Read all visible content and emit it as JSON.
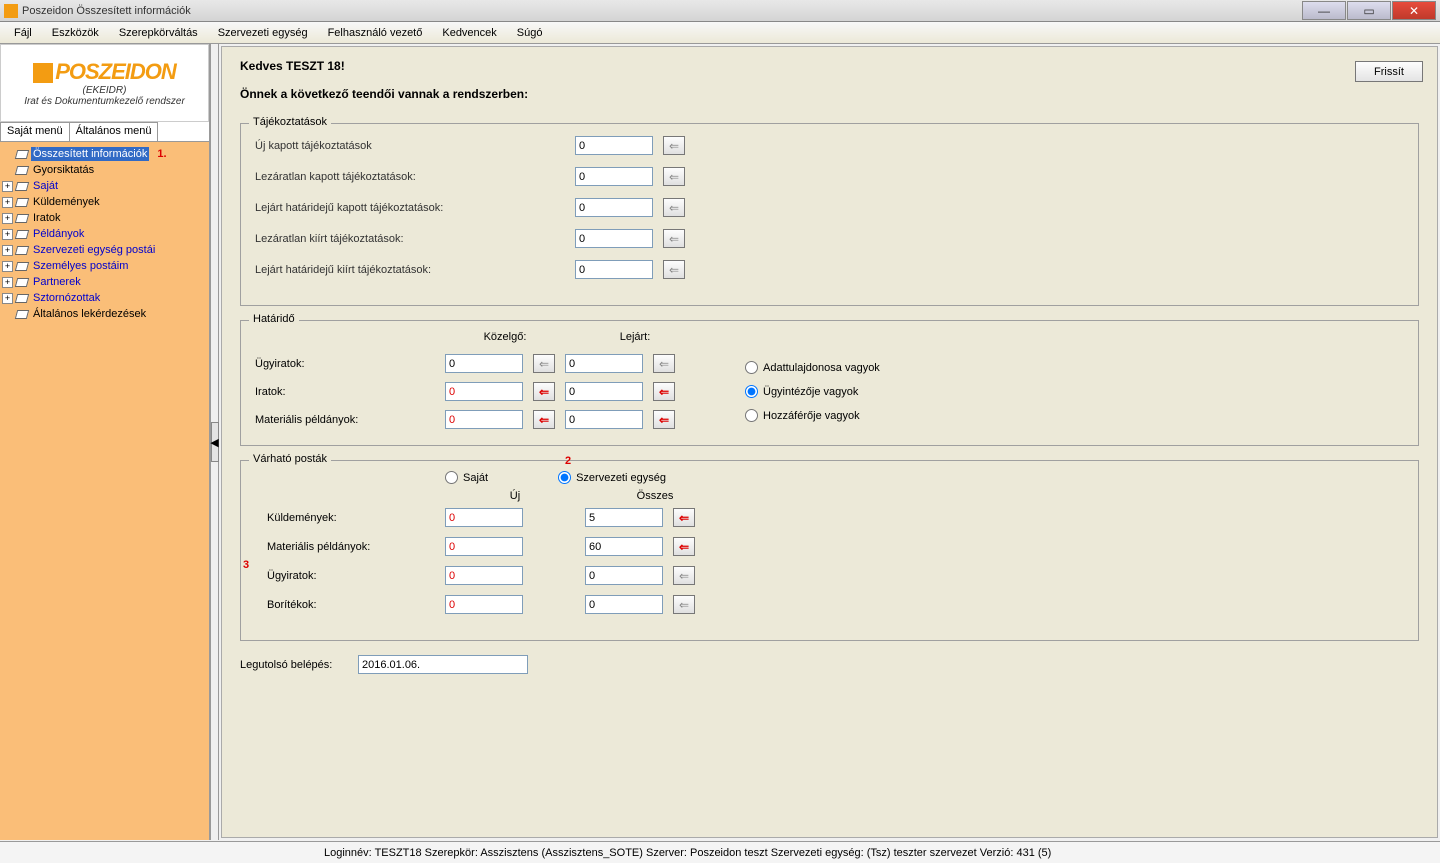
{
  "title": "Poszeidon Összesített információk",
  "menubar": [
    "Fájl",
    "Eszközök",
    "Szerepkörváltás",
    "Szervezeti egység",
    "Felhasználó vezető",
    "Kedvencek",
    "Súgó"
  ],
  "logo": {
    "main": "POSZEIDON",
    "sub1": "(EKEIDR)",
    "sub2": "Irat és Dokumentumkezelő rendszer"
  },
  "menu_tabs": {
    "own": "Saját menü",
    "general": "Általános menü"
  },
  "tree": {
    "items": [
      {
        "label": "Összesített információk",
        "black": false,
        "selected": true,
        "expand": false,
        "ann": "1."
      },
      {
        "label": "Gyorsiktatás",
        "black": true,
        "expand": false
      },
      {
        "label": "Saját",
        "black": false,
        "expand": true
      },
      {
        "label": "Küldemények",
        "black": true,
        "expand": true
      },
      {
        "label": "Iratok",
        "black": true,
        "expand": true
      },
      {
        "label": "Példányok",
        "black": false,
        "expand": true
      },
      {
        "label": "Szervezeti egység postái",
        "black": false,
        "expand": true
      },
      {
        "label": "Személyes postáim",
        "black": false,
        "expand": true
      },
      {
        "label": "Partnerek",
        "black": false,
        "expand": true
      },
      {
        "label": "Sztornózottak",
        "black": false,
        "expand": true
      },
      {
        "label": "Általános lekérdezések",
        "black": true,
        "expand": false
      }
    ]
  },
  "content": {
    "greeting": "Kedves TESZT 18!",
    "subgreeting": "Önnek a következő teendői vannak a rendszerben:",
    "refresh": "Frissít",
    "tajek": {
      "title": "Tájékoztatások",
      "rows": [
        {
          "label": "Új kapott tájékoztatások",
          "val": "0"
        },
        {
          "label": "Lezáratlan kapott tájékoztatások:",
          "val": "0"
        },
        {
          "label": "Lejárt határidejű kapott tájékoztatások:",
          "val": "0"
        },
        {
          "label": "Lezáratlan kiírt tájékoztatások:",
          "val": "0"
        },
        {
          "label": "Lejárt határidejű kiírt tájékoztatások:",
          "val": "0"
        }
      ]
    },
    "hatarido": {
      "title": "Határidő",
      "col1": "Közelgő:",
      "col2": "Lejárt:",
      "rows": [
        {
          "label": "Ügyiratok:",
          "v1": "0",
          "v2": "0",
          "red": false
        },
        {
          "label": "Iratok:",
          "v1": "0",
          "v2": "0",
          "red": true
        },
        {
          "label": "Materiális példányok:",
          "v1": "0",
          "v2": "0",
          "red": true
        }
      ],
      "radios": [
        {
          "label": "Adattulajdonosa vagyok",
          "checked": false
        },
        {
          "label": "Ügyintézője vagyok",
          "checked": true
        },
        {
          "label": "Hozzáférője vagyok",
          "checked": false
        }
      ]
    },
    "varhato": {
      "title": "Várható posták",
      "ann": "2",
      "optSajat": "Saját",
      "optSzerv": "Szervezeti egység",
      "colUj": "Új",
      "colOsszes": "Összes",
      "ann3": "3",
      "rows": [
        {
          "label": "Küldemények:",
          "v1": "0",
          "v2": "5",
          "red": true
        },
        {
          "label": "Materiális példányok:",
          "v1": "0",
          "v2": "60",
          "red": true
        },
        {
          "label": "Ügyiratok:",
          "v1": "0",
          "v2": "0",
          "red": false
        },
        {
          "label": "Borítékok:",
          "v1": "0",
          "v2": "0",
          "red": false
        }
      ]
    },
    "lastLoginLabel": "Legutolsó belépés:",
    "lastLoginVal": "2016.01.06."
  },
  "status": "Loginnév: TESZT18   Szerepkör: Asszisztens (Asszisztens_SOTE)   Szerver: Poszeidon teszt   Szervezeti egység: (Tsz) teszter szervezet   Verzió: 431 (5)"
}
